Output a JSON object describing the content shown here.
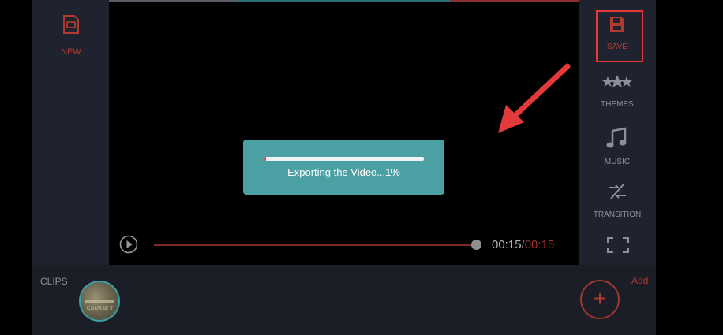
{
  "left_panel": {
    "new_label": "NEW"
  },
  "right_panel": {
    "tools": [
      {
        "label": "SAVE",
        "icon": "save-icon"
      },
      {
        "label": "THEMES",
        "icon": "stars-icon"
      },
      {
        "label": "MUSIC",
        "icon": "music-note-icon"
      },
      {
        "label": "TRANSITION",
        "icon": "transition-icon"
      },
      {
        "label": "",
        "icon": "fullscreen-icon"
      }
    ]
  },
  "export_dialog": {
    "message": "Exporting the Video...1%",
    "progress_percent": 1
  },
  "player": {
    "current_time": "00:15",
    "separator": "/",
    "total_time": "00:15",
    "seek_fraction": 1.0
  },
  "clips": {
    "label": "CLIPS",
    "thumbnail_caption": "COURSE T",
    "add_label": "Add",
    "add_symbol": "+"
  },
  "colors": {
    "accent_red": "#b13a30",
    "dialog_teal": "#4aa0a3",
    "annotation_red": "#e23a3a"
  }
}
